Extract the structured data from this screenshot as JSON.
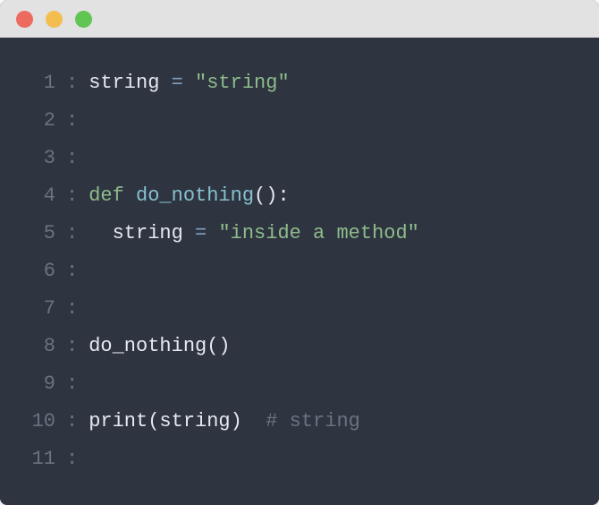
{
  "window": {
    "buttons": {
      "close": "red",
      "minimize": "yellow",
      "maximize": "green"
    }
  },
  "code": {
    "lines": [
      {
        "n": "1",
        "tokens": [
          {
            "t": "string ",
            "c": "plain"
          },
          {
            "t": "=",
            "c": "kw"
          },
          {
            "t": " ",
            "c": "plain"
          },
          {
            "t": "\"string\"",
            "c": "str"
          }
        ]
      },
      {
        "n": "2",
        "tokens": []
      },
      {
        "n": "3",
        "tokens": []
      },
      {
        "n": "4",
        "tokens": [
          {
            "t": "def",
            "c": "def-kw"
          },
          {
            "t": " ",
            "c": "plain"
          },
          {
            "t": "do_nothing",
            "c": "fn"
          },
          {
            "t": "():",
            "c": "plain"
          }
        ]
      },
      {
        "n": "5",
        "tokens": [
          {
            "t": "  string ",
            "c": "plain"
          },
          {
            "t": "=",
            "c": "kw"
          },
          {
            "t": " ",
            "c": "plain"
          },
          {
            "t": "\"inside a method\"",
            "c": "str"
          }
        ]
      },
      {
        "n": "6",
        "tokens": []
      },
      {
        "n": "7",
        "tokens": []
      },
      {
        "n": "8",
        "tokens": [
          {
            "t": "do_nothing()",
            "c": "plain"
          }
        ]
      },
      {
        "n": "9",
        "tokens": []
      },
      {
        "n": "10",
        "tokens": [
          {
            "t": "print",
            "c": "plain"
          },
          {
            "t": "(string)  ",
            "c": "plain"
          },
          {
            "t": "# string",
            "c": "comment"
          }
        ]
      },
      {
        "n": "11",
        "tokens": []
      }
    ]
  }
}
